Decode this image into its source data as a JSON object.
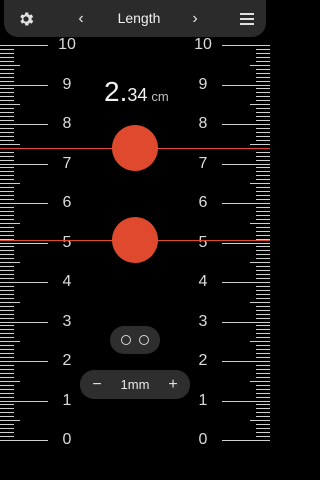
{
  "header": {
    "title": "Length",
    "prev_label": "‹",
    "next_label": "›",
    "settings_icon": "gear-icon",
    "menu_icon": "hamburger-menu-icon"
  },
  "measurement": {
    "integer": "2.",
    "decimal": "34",
    "unit": "cm"
  },
  "scale": {
    "labels": [
      "10",
      "9",
      "8",
      "7",
      "6",
      "5",
      "4",
      "3",
      "2",
      "1",
      "0"
    ],
    "unit": "cm"
  },
  "markers": {
    "upper_value_cm": 7.4,
    "lower_value_cm": 5.06,
    "color": "#df4a2f"
  },
  "controls": {
    "toggle_icon": "two-dots-icon",
    "step_minus": "−",
    "step_value": "1mm",
    "step_plus": "+"
  }
}
